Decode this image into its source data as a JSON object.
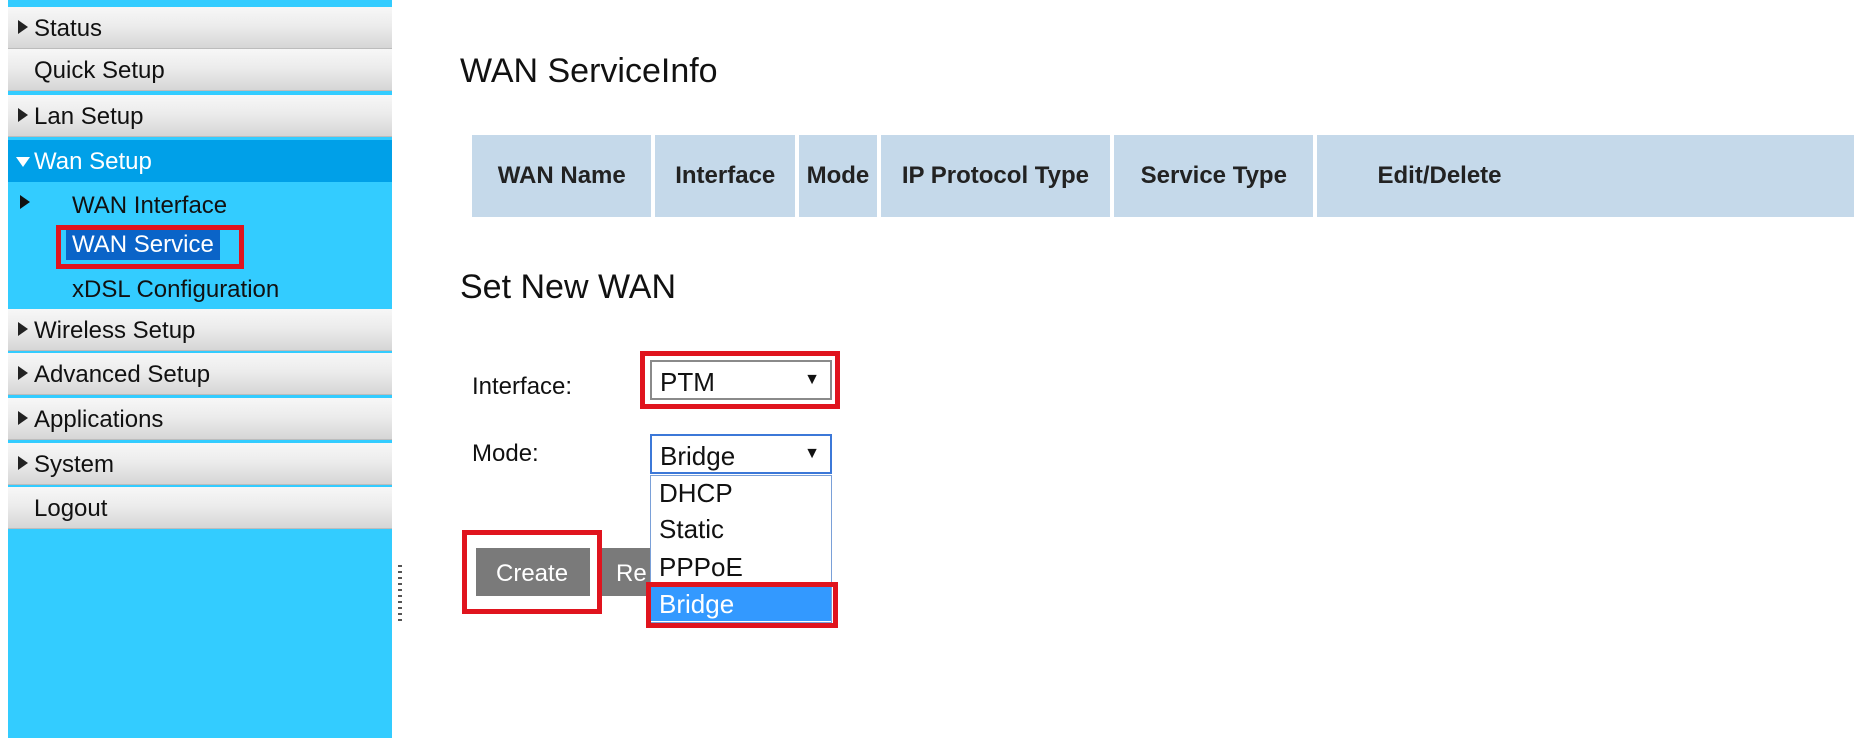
{
  "sidebar": {
    "items": [
      {
        "label": "Status"
      },
      {
        "label": "Quick Setup"
      },
      {
        "label": "Lan Setup"
      },
      {
        "label": "Wan Setup"
      },
      {
        "label": "Wireless Setup"
      },
      {
        "label": "Advanced Setup"
      },
      {
        "label": "Applications"
      },
      {
        "label": "System"
      },
      {
        "label": "Logout"
      }
    ],
    "wan_subitems": [
      {
        "label": "WAN Interface"
      },
      {
        "label": "WAN Service"
      },
      {
        "label": "xDSL Configuration"
      }
    ]
  },
  "main": {
    "service_info_title": "WAN ServiceInfo",
    "table_headers": [
      "WAN Name",
      "Interface",
      "Mode",
      "IP Protocol Type",
      "Service Type",
      "Edit/Delete"
    ],
    "set_new_title": "Set New WAN",
    "form": {
      "interface_label": "Interface:",
      "interface_value": "PTM",
      "mode_label": "Mode:",
      "mode_value": "Bridge",
      "mode_options": [
        "DHCP",
        "Static",
        "PPPoE",
        "Bridge"
      ]
    },
    "buttons": {
      "create": "Create",
      "second_partial": "Re"
    }
  },
  "colors": {
    "sidebar_bg": "#33ccff",
    "nav_active": "#00a0e8",
    "highlight_box": "#e0141e",
    "table_header": "#c5d9ea",
    "dropdown_selected": "#3399ff"
  }
}
